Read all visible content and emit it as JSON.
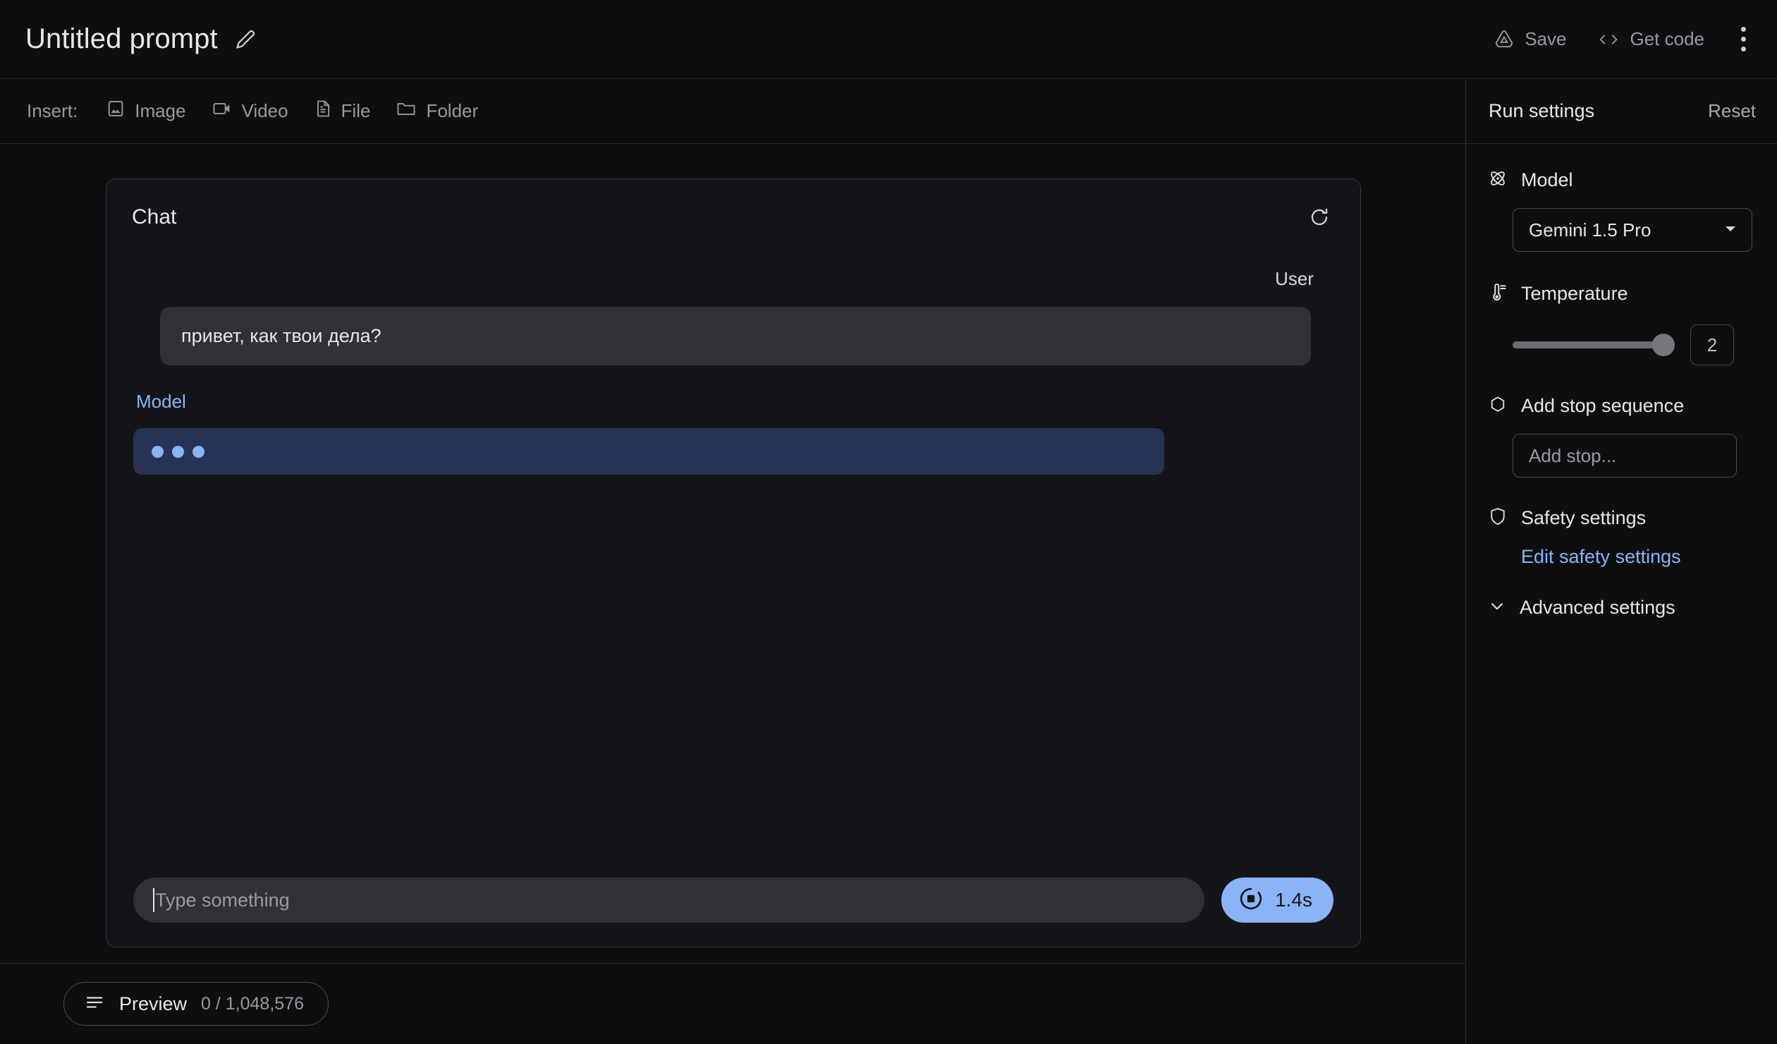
{
  "topbar": {
    "title": "Untitled prompt",
    "edit_icon": "pencil-icon",
    "save_label": "Save",
    "get_code_label": "Get code",
    "menu_icon": "kebab-menu-icon"
  },
  "insertbar": {
    "label": "Insert:",
    "items": [
      {
        "label": "Image",
        "icon": "image-icon"
      },
      {
        "label": "Video",
        "icon": "video-icon"
      },
      {
        "label": "File",
        "icon": "file-icon"
      },
      {
        "label": "Folder",
        "icon": "folder-icon"
      }
    ]
  },
  "chat": {
    "header_title": "Chat",
    "refresh_icon": "refresh-icon",
    "turns": [
      {
        "role": "User",
        "text": "привет, как твои дела?"
      },
      {
        "role": "Model",
        "text": ""
      }
    ],
    "user_label": "User",
    "user_message": "привет, как твои дела?",
    "model_label": "Model",
    "model_loading": true,
    "composer_placeholder": "Type something",
    "run_button_time": "1.4s",
    "run_button_icon": "stop-circle-icon"
  },
  "run_settings": {
    "title": "Run settings",
    "reset_label": "Reset",
    "model": {
      "label": "Model",
      "icon": "atom-icon",
      "selected": "Gemini 1.5 Pro"
    },
    "temperature": {
      "label": "Temperature",
      "icon": "thermometer-icon",
      "value": "2",
      "slider_percent": 96
    },
    "stop_sequence": {
      "label": "Add stop sequence",
      "icon": "hexagon-icon",
      "placeholder": "Add stop..."
    },
    "safety": {
      "label": "Safety settings",
      "icon": "shield-icon",
      "edit_link": "Edit safety settings"
    },
    "advanced": {
      "label": "Advanced settings",
      "icon": "chevron-down-icon"
    }
  },
  "bottombar": {
    "preview_label": "Preview",
    "token_count": "0 / 1,048,576",
    "preview_icon": "token-count-icon"
  },
  "colors": {
    "background": "#0e0e11",
    "accent_blue": "#8ab4f8",
    "model_bubble": "#273354",
    "user_bubble": "#303136",
    "border": "#2a2b2f"
  }
}
